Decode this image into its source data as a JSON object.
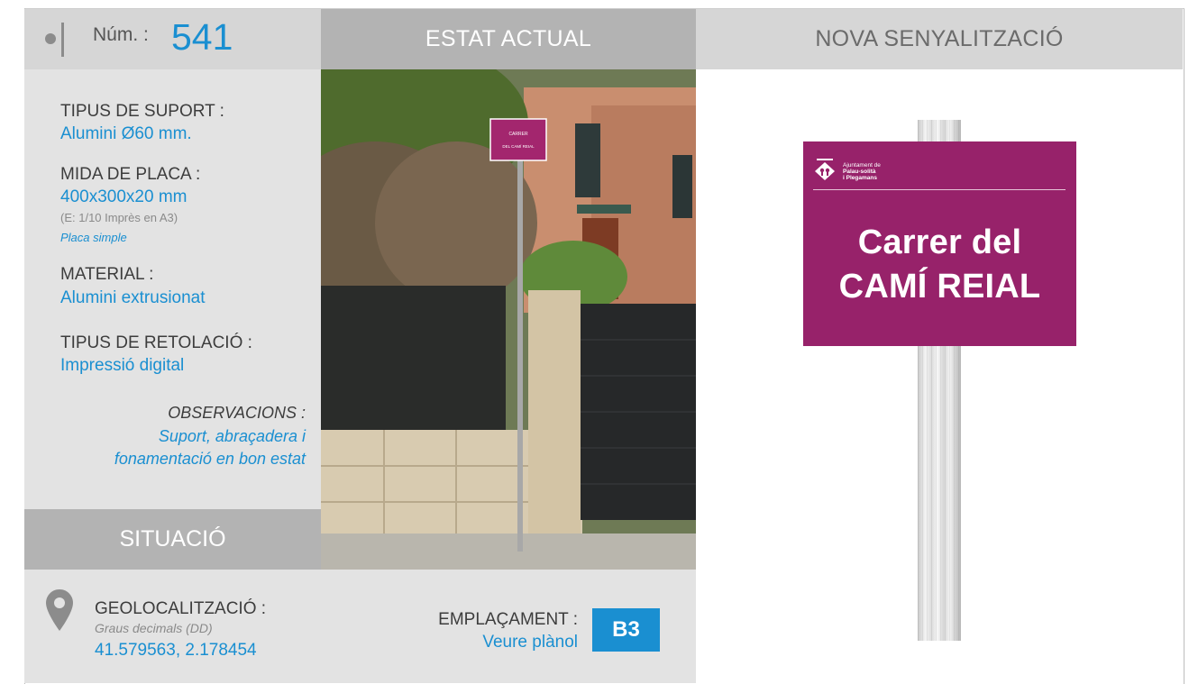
{
  "header": {
    "num_label": "Núm. :",
    "num_value": "541",
    "estat_title": "ESTAT ACTUAL",
    "nova_title": "NOVA SENYALITZACIÓ"
  },
  "info": {
    "suport_label": "TIPUS DE SUPORT :",
    "suport_value": "Alumini Ø60 mm.",
    "mida_label": "MIDA DE PLACA :",
    "mida_value": "400x300x20 mm",
    "mida_scale": "(E: 1/10 Imprès en A3)",
    "mida_note": "Placa simple",
    "material_label": "MATERIAL :",
    "material_value": "Alumini extrusionat",
    "retolacio_label": "TIPUS DE RETOLACIÓ :",
    "retolacio_value": "Impressió digital",
    "obs_label": "OBSERVACIONS :",
    "obs_line1": "Suport, abraçadera i",
    "obs_line2": "fonamentació en bon estat"
  },
  "situacio": {
    "title": "SITUACIÓ",
    "geo_label": "GEOLOCALITZACIÓ :",
    "geo_format": "Graus decimals (DD)",
    "geo_value": "41.579563, 2.178454",
    "empl_label": "EMPLAÇAMENT :",
    "empl_link": "Veure plànol",
    "empl_code": "B3"
  },
  "photo_sign": {
    "line1": "CARRER",
    "line2": "DEL CAMÍ REIAL"
  },
  "new_sign": {
    "logo_line1": "Ajuntament de",
    "logo_line2": "Palau-solità",
    "logo_line3": "i Plegamans",
    "line1": "Carrer del",
    "line2": "CAMÍ REIAL",
    "plate_color": "#97226a"
  },
  "colors": {
    "accent": "#1a8fd1",
    "header_dark": "#b3b3b3",
    "header_light": "#d6d6d6",
    "panel": "#e3e3e3"
  }
}
